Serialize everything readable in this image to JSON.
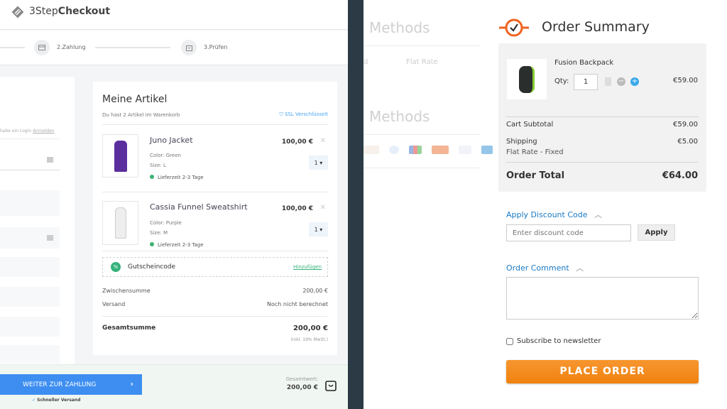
{
  "left": {
    "brand": {
      "prefix": "3Step",
      "bold": "Checkout"
    },
    "steps": [
      {
        "label": "2.Zahlung",
        "icon": "credit-card-icon"
      },
      {
        "label": "3.Prüfen",
        "icon": "shopping-bag-icon"
      }
    ],
    "login_hint": "habe ein Login",
    "login_link": "Anmelden",
    "cart": {
      "title": "Meine Artikel",
      "subtitle": "Du hast 2 Artikel im Warenkorb",
      "ssl": "SSL Verschlüsselt",
      "items": [
        {
          "name": "Juno Jacket",
          "color_label": "Color:",
          "color": "Green",
          "size_label": "Size:",
          "size": "L",
          "delivery_label": "Lieferzeit",
          "delivery": "2-3 Tage",
          "price": "100,00 €",
          "qty": "1"
        },
        {
          "name": "Cassia Funnel Sweatshirt",
          "color_label": "Color:",
          "color": "Purple",
          "size_label": "Size:",
          "size": "M",
          "delivery_label": "Lieferzeit",
          "delivery": "2-3 Tage",
          "price": "100,00 €",
          "qty": "1"
        }
      ],
      "coupon": {
        "label": "Gutscheincode",
        "link": "Hinzufügen"
      },
      "subtotal_label": "Zwischensumme",
      "subtotal": "200,00 €",
      "shipping_label": "Versand",
      "shipping": "Noch nicht berechnet",
      "total_label": "Gesamtsumme",
      "total": "200,00 €",
      "tax_note": "(inkl. 19% MwSt.)"
    },
    "bottom": {
      "button": "WEITER ZUR ZAHLUNG",
      "fast": "Schneller Versand",
      "total_label": "Gesamtwert:",
      "total": "200,00 €"
    }
  },
  "right": {
    "shipping_heading": "Methods",
    "shipping_partial": "d",
    "flat_rate": "Flat Rate",
    "payment_heading": "Methods",
    "card_brands": [
      "discover",
      "diners",
      "jcb",
      "mastercard",
      "visa",
      "amex"
    ],
    "summary": {
      "title": "Order Summary",
      "item": {
        "name": "Fusion Backpack",
        "qty_label": "Qty:",
        "qty": "1",
        "price": "€59.00"
      },
      "subtotal_label": "Cart Subtotal",
      "subtotal": "€59.00",
      "shipping_label": "Shipping",
      "shipping": "€5.00",
      "shipping_method": "Flat Rate - Fixed",
      "total_label": "Order Total",
      "total": "€64.00"
    },
    "discount": {
      "label": "Apply Discount Code",
      "placeholder": "Enter discount code",
      "button": "Apply"
    },
    "comment": {
      "label": "Order Comment"
    },
    "newsletter": "Subscribe to newsletter",
    "place_order": "PLACE ORDER",
    "colors": {
      "accent": "#f58a1f",
      "link": "#1979c3",
      "primary_left": "#3d8ef0"
    }
  }
}
